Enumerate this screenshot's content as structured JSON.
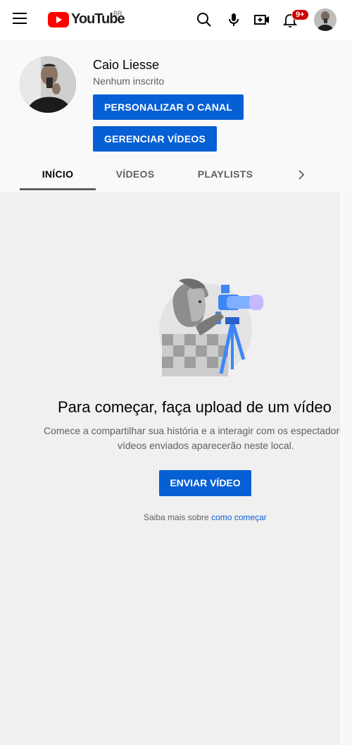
{
  "header": {
    "logo_text": "YouTube",
    "country_code": "BR",
    "notifications_count": "9+"
  },
  "channel": {
    "name": "Caio Liesse",
    "subscribers": "Nenhum inscrito",
    "customize_button": "PERSONALIZAR O CANAL",
    "manage_button": "GERENCIAR VÍDEOS"
  },
  "tabs": [
    {
      "label": "INÍCIO",
      "active": true
    },
    {
      "label": "VÍDEOS",
      "active": false
    },
    {
      "label": "PLAYLISTS",
      "active": false
    }
  ],
  "empty_state": {
    "title": "Para começar, faça upload de um vídeo",
    "description_line1": "Comece a compartilhar sua história e a interagir com os espectadores. Os",
    "description_line2": "vídeos enviados aparecerão neste local.",
    "upload_button": "ENVIAR VÍDEO",
    "learn_prefix": "Saiba mais sobre",
    "learn_link": "como começar"
  },
  "colors": {
    "accent": "#065fd4",
    "brand_red": "#ff0000",
    "badge_red": "#cc0000",
    "background": "#f0f0f0"
  },
  "icons": [
    "menu-icon",
    "youtube-logo-icon",
    "search-icon",
    "mic-icon",
    "create-video-icon",
    "bell-icon",
    "chevron-right-icon"
  ]
}
